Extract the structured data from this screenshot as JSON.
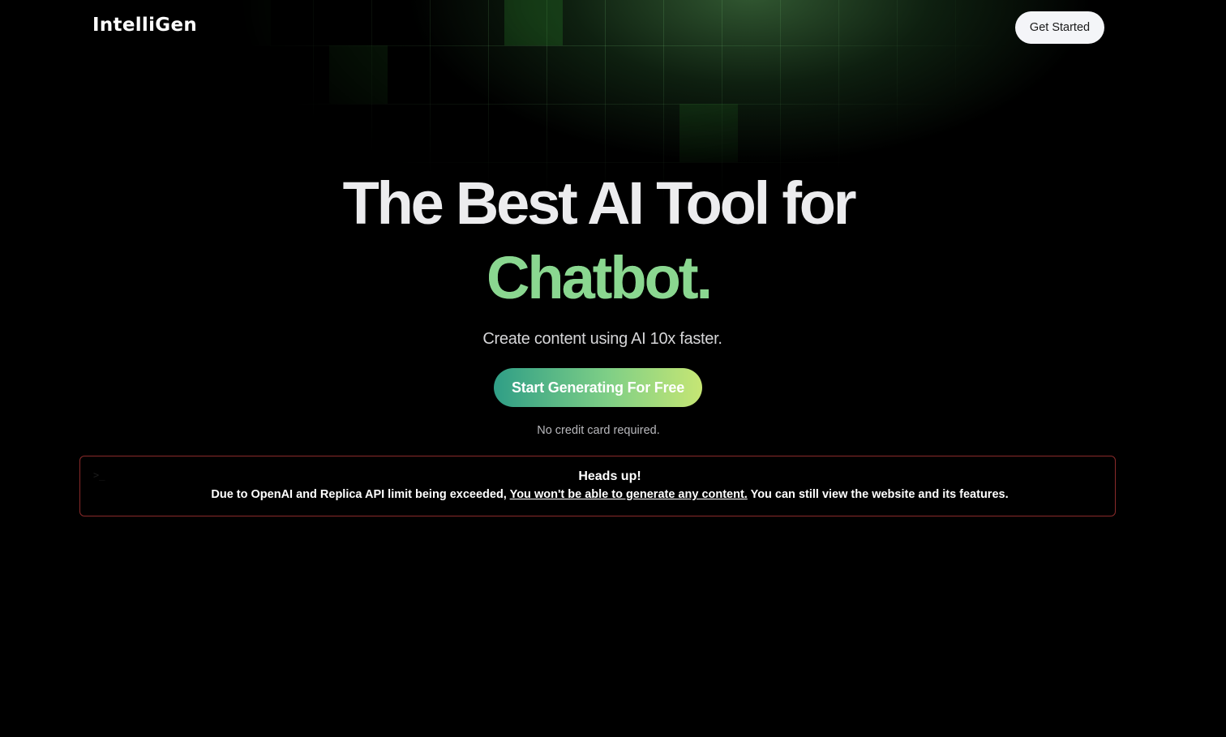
{
  "header": {
    "logo": "IntelliGen",
    "cta_label": "Get Started"
  },
  "hero": {
    "title_line1": "The Best AI Tool for",
    "title_highlight": "Chatbot.",
    "subtitle": "Create content using AI 10x faster.",
    "cta_label": "Start Generating For Free",
    "note": "No credit card required."
  },
  "alert": {
    "icon": "terminal-icon",
    "title": "Heads up!",
    "body_before": "Due to OpenAI and Replica API limit being exceeded, ",
    "body_link": "You won't be able to generate any content.",
    "body_after": " You can still view the website and its features."
  },
  "colors": {
    "background": "#000000",
    "accent_green": "#8ad790",
    "cta_gradient_start": "#2f9e86",
    "cta_gradient_end": "#c6e674",
    "alert_border": "#8a2a2a"
  }
}
